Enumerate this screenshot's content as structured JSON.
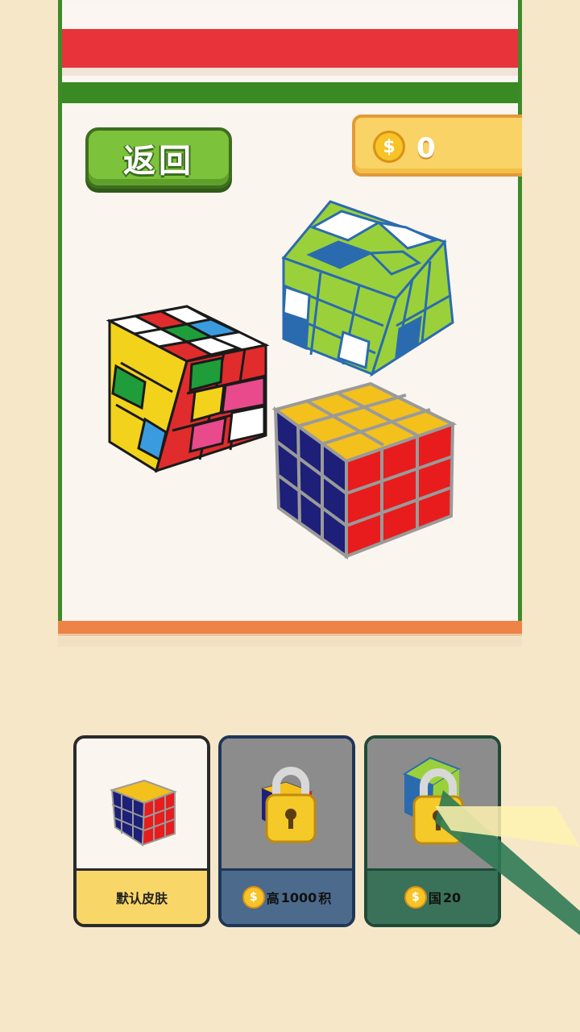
{
  "header": {
    "back_label": "返回"
  },
  "wallet": {
    "coin_symbol": "$",
    "amount": "0"
  },
  "skins": [
    {
      "label": "默认皮肤",
      "locked": false
    },
    {
      "price_prefix": "高",
      "price": "1000",
      "price_suffix": "积",
      "locked": true
    },
    {
      "price_prefix": "国",
      "price": "20",
      "locked": true
    }
  ],
  "colors": {
    "accent_green": "#7cc23a",
    "banner_red": "#e8333a",
    "coin_gold": "#f7c428"
  }
}
